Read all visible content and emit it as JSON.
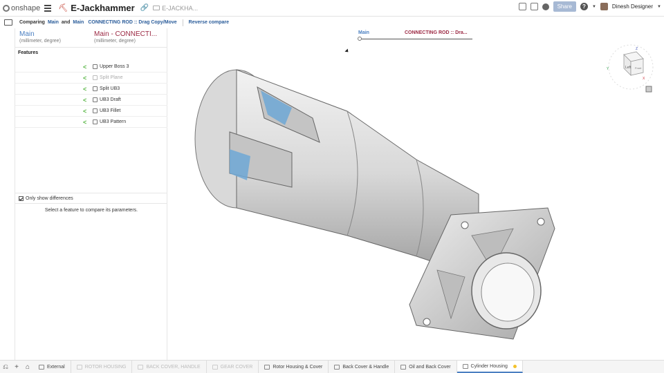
{
  "header": {
    "logo_text": "onshape",
    "document_title": "E-Jackhammer",
    "breadcrumb": "E-JACKHA...",
    "share_label": "Share",
    "user_name": "Dinesh Designer"
  },
  "compare_bar": {
    "comparing_label": "Comparing",
    "version_a": "Main",
    "and_label": "and",
    "version_b_branch": "Main",
    "version_b_name": "CONNECTING ROD :: Drag Copy/Move",
    "reverse_label": "Reverse compare"
  },
  "panel": {
    "col_a_name": "Main",
    "col_a_units": "(millimeter, degree)",
    "col_b_name": "Main - CONNECTI...",
    "col_b_units": "(millimeter, degree)",
    "features_label": "Features",
    "features": [
      {
        "name": "Upper Boss 3",
        "icon": "extrude-icon",
        "muted": false
      },
      {
        "name": "Split Plane",
        "icon": "plane-icon",
        "muted": true
      },
      {
        "name": "Split UB3",
        "icon": "split-icon",
        "muted": false
      },
      {
        "name": "UB3 Draft",
        "icon": "draft-icon",
        "muted": false
      },
      {
        "name": "UB3 Fillet",
        "icon": "fillet-icon",
        "muted": false
      },
      {
        "name": "UB3 Pattern",
        "icon": "pattern-icon",
        "muted": false
      }
    ],
    "only_differences_label": "Only show differences",
    "only_differences_checked": true,
    "select_message": "Select a feature to compare its parameters."
  },
  "viewport": {
    "legend_a": "Main",
    "legend_b": "CONNECTING ROD :: Dra...",
    "viewcube_face": "Left",
    "viewcube_face_b": "Front",
    "axis_x": "X",
    "axis_y": "Y",
    "axis_z": "Z",
    "colors": {
      "legend_a": "#4a7fc1",
      "legend_b": "#9c2a44",
      "diff_highlight": "#6fa8d6"
    }
  },
  "tabs": [
    {
      "label": "External",
      "state": "normal",
      "icon": "folder-icon"
    },
    {
      "label": "ROTOR HOUSING",
      "state": "muted",
      "icon": "part-studio-icon"
    },
    {
      "label": "BACK COVER, HANDLE",
      "state": "muted",
      "icon": "part-studio-icon"
    },
    {
      "label": "GEAR COVER",
      "state": "muted",
      "icon": "part-studio-icon"
    },
    {
      "label": "Rotor Housing & Cover",
      "state": "normal",
      "icon": "part-studio-icon"
    },
    {
      "label": "Back Cover & Handle",
      "state": "normal",
      "icon": "part-studio-icon"
    },
    {
      "label": "Oil and Back Cover",
      "state": "normal",
      "icon": "part-studio-icon"
    },
    {
      "label": "Cylinder Housing",
      "state": "active",
      "icon": "part-studio-icon"
    }
  ]
}
